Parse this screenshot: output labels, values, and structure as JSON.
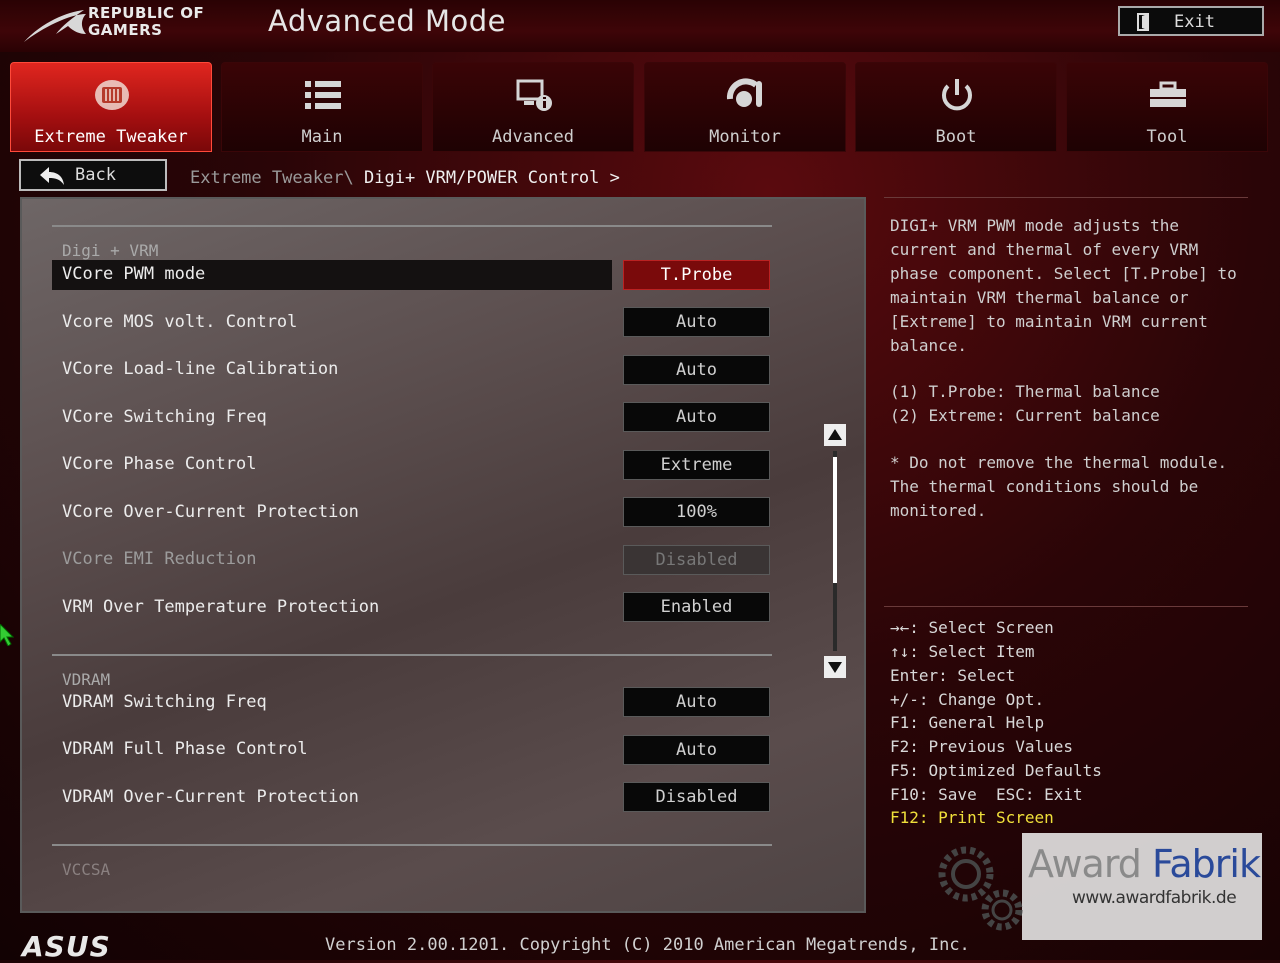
{
  "header": {
    "brand_line1": "REPUBLIC OF",
    "brand_line2": "GAMERS",
    "mode_title": "Advanced Mode",
    "exit_label": "Exit"
  },
  "tabs": [
    {
      "label": "Extreme Tweaker",
      "icon": "tweaker-icon",
      "active": true
    },
    {
      "label": "Main",
      "icon": "list-icon",
      "active": false
    },
    {
      "label": "Advanced",
      "icon": "advanced-settings-icon",
      "active": false
    },
    {
      "label": "Monitor",
      "icon": "monitor-icon",
      "active": false
    },
    {
      "label": "Boot",
      "icon": "power-icon",
      "active": false
    },
    {
      "label": "Tool",
      "icon": "toolbox-icon",
      "active": false
    }
  ],
  "nav": {
    "back_label": "Back",
    "breadcrumb_parent": "Extreme Tweaker\\ ",
    "breadcrumb_current": "Digi+ VRM/POWER Control >"
  },
  "sections": {
    "digi_vrm": "Digi + VRM",
    "vdram": "VDRAM",
    "vccsa": "VCCSA"
  },
  "items": [
    {
      "label": "VCore PWM mode",
      "value": "T.Probe",
      "state": "selected"
    },
    {
      "label": "Vcore MOS volt. Control",
      "value": "Auto",
      "state": "normal"
    },
    {
      "label": "VCore Load-line Calibration",
      "value": "Auto",
      "state": "normal"
    },
    {
      "label": "VCore Switching Freq",
      "value": "Auto",
      "state": "normal"
    },
    {
      "label": "VCore Phase Control",
      "value": "Extreme",
      "state": "normal"
    },
    {
      "label": "VCore Over-Current Protection",
      "value": "100%",
      "state": "normal"
    },
    {
      "label": "VCore EMI Reduction",
      "value": "Disabled",
      "state": "disabled"
    },
    {
      "label": "VRM Over Temperature Protection",
      "value": "Enabled",
      "state": "normal"
    },
    {
      "label": "VDRAM Switching Freq",
      "value": "Auto",
      "state": "normal"
    },
    {
      "label": "VDRAM Full Phase Control",
      "value": "Auto",
      "state": "normal"
    },
    {
      "label": "VDRAM Over-Current Protection",
      "value": "Disabled",
      "state": "normal"
    }
  ],
  "help": {
    "description": "DIGI+ VRM PWM mode adjusts the\ncurrent and thermal of every VRM\nphase component. Select [T.Probe] to\nmaintain VRM thermal balance or\n[Extreme] to maintain VRM current\nbalance.",
    "options": "(1) T.Probe: Thermal balance\n(2) Extreme: Current balance",
    "note": "* Do not remove the thermal module.\nThe thermal conditions should be\nmonitored."
  },
  "keys": [
    "→←: Select Screen",
    "↑↓: Select Item",
    "Enter: Select",
    "+/-: Change Opt.",
    "F1: General Help",
    "F2: Previous Values",
    "F5: Optimized Defaults",
    "F10: Save  ESC: Exit",
    "F12: Print Screen"
  ],
  "watermark": {
    "title_a": "Award ",
    "title_b": "Fabrik",
    "url": "www.awardfabrik.de"
  },
  "footer": {
    "brand": "ASUS",
    "version": "Version 2.00.1201. Copyright (C) 2010 American Megatrends, Inc."
  },
  "colors": {
    "accent_red": "#c41414",
    "selected_value_bg": "#7a0a0b",
    "highlight_key": "#f0e03a"
  }
}
